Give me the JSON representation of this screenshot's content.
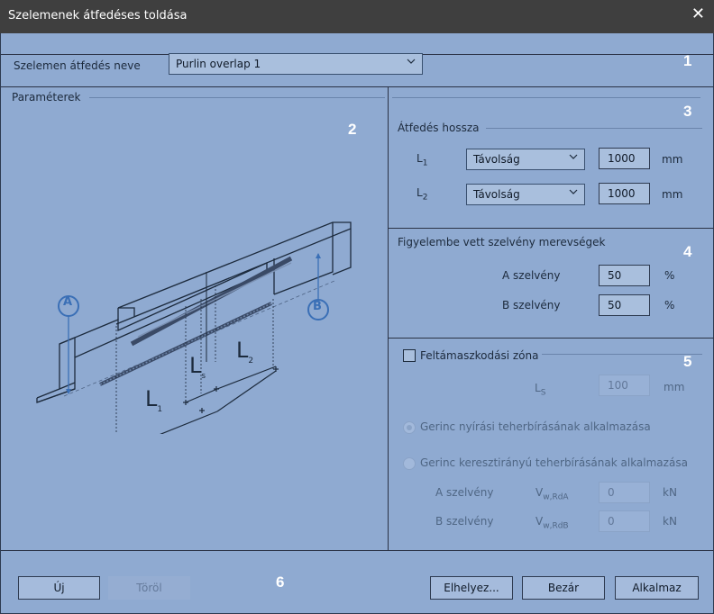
{
  "window": {
    "title": "Szelemenek átfedéses toldása",
    "close_glyph": "✕"
  },
  "header": {
    "name_label": "Szelemen átfedés neve",
    "name_value": "Purlin overlap 1"
  },
  "parameters": {
    "title": "Paraméterek"
  },
  "overlap_length": {
    "title": "Átfedés hossza",
    "rows": [
      {
        "label": "L",
        "sub": "1",
        "mode": "Távolság",
        "value": "1000",
        "unit": "mm"
      },
      {
        "label": "L",
        "sub": "2",
        "mode": "Távolság",
        "value": "1000",
        "unit": "mm"
      }
    ]
  },
  "stiffness": {
    "title": "Figyelembe vett szelvény merevségek",
    "rows": [
      {
        "label": "A szelvény",
        "value": "50",
        "unit": "%"
      },
      {
        "label": "B szelvény",
        "value": "50",
        "unit": "%"
      }
    ]
  },
  "support_zone": {
    "checkbox_label": "Feltámaszkodási zóna",
    "checked": false,
    "ls_label": "L",
    "ls_sub": "S",
    "ls_value": "100",
    "ls_unit": "mm",
    "option1": "Gerinc nyírási teherbírásának alkalmazása",
    "option2": "Gerinc keresztirányú teherbírásának alkalmazása",
    "rows": [
      {
        "label": "A szelvény",
        "symbol": "V",
        "sub": "w,RdA",
        "value": "0",
        "unit": "kN"
      },
      {
        "label": "B szelvény",
        "symbol": "V",
        "sub": "w,RdB",
        "value": "0",
        "unit": "kN"
      }
    ]
  },
  "drawing_labels": {
    "a": "A",
    "b": "B",
    "l1": "L",
    "l1_sub": "1",
    "l2": "L",
    "l2_sub": "2",
    "ls": "L",
    "ls_sub": "s"
  },
  "section_numbers": [
    "1",
    "2",
    "3",
    "4",
    "5",
    "6"
  ],
  "footer": {
    "new": "Új",
    "delete": "Töröl",
    "place": "Elhelyez...",
    "close": "Bezár",
    "apply": "Alkalmaz"
  },
  "colors": {
    "panel": "#8faad1",
    "titlebar": "#3f3f3f",
    "accent_text": "#ffffff",
    "diagram_accent": "#3a6fb6"
  }
}
